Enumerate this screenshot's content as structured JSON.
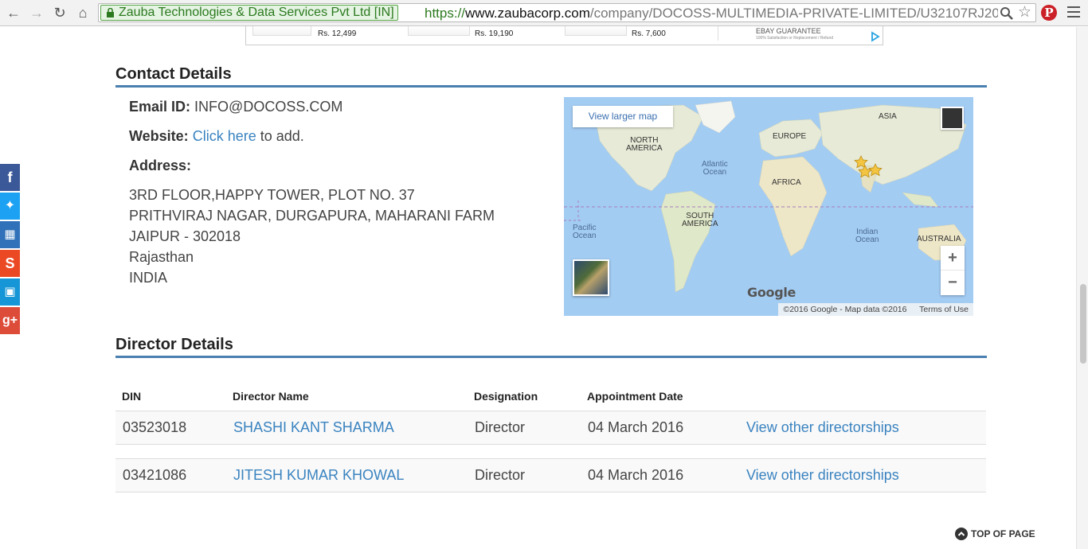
{
  "browser": {
    "ssl_label": "Zauba Technologies & Data Services Pvt Ltd [IN]",
    "url_scheme": "https://",
    "url_host": "www.zaubacorp.com",
    "url_path": "/company/DOCOSS-MULTIMEDIA-PRIVATE-LIMITED/U32107RJ20"
  },
  "ad": {
    "prices": [
      "Rs. 12,499",
      "Rs. 19,190",
      "Rs. 7,600"
    ],
    "guarantee": "EBAY GUARANTEE",
    "guarantee_sub": "100% Satisfaction or Replacement / Refund"
  },
  "social": [
    "facebook-icon",
    "twitter-icon",
    "delicious-icon",
    "stumbleupon-icon",
    "delicious-alt-icon",
    "google-plus-icon"
  ],
  "contact": {
    "title": "Contact Details",
    "email_label": "Email ID:",
    "email_value": "INFO@DOCOSS.COM",
    "website_label": "Website:",
    "website_link": "Click here",
    "website_suffix": "to add.",
    "address_label": "Address:",
    "address_lines": [
      "3RD FLOOR,HAPPY TOWER, PLOT NO. 37",
      "PRITHVIRAJ NAGAR, DURGAPURA, MAHARANI FARM",
      "JAIPUR - 302018",
      "Rajasthan",
      "INDIA"
    ]
  },
  "map": {
    "view_larger": "View larger map",
    "zoom_in": "+",
    "zoom_out": "−",
    "logo": "Google",
    "attribution": "©2016 Google - Map data ©2016",
    "terms": "Terms of Use",
    "labels": {
      "asia": "ASIA",
      "north_america": "NORTH\nAMERICA",
      "europe": "EUROPE",
      "atlantic": "Atlantic\nOcean",
      "africa": "AFRICA",
      "south_america": "SOUTH\nAMERICA",
      "pacific": "Pacific\nOcean",
      "indian": "Indian\nOcean",
      "australia": "AUSTRALIA"
    }
  },
  "directors": {
    "title": "Director Details",
    "headers": [
      "DIN",
      "Director Name",
      "Designation",
      "Appointment Date"
    ],
    "rows": [
      {
        "din": "03523018",
        "name": "SHASHI KANT SHARMA",
        "designation": "Director",
        "date": "04 March 2016",
        "action": "View other directorships"
      },
      {
        "din": "03421086",
        "name": "JITESH KUMAR KHOWAL",
        "designation": "Director",
        "date": "04 March 2016",
        "action": "View other directorships"
      }
    ]
  },
  "footer": {
    "top_of_page": "TOP OF PAGE"
  },
  "colors": {
    "accent": "#3a83c0",
    "rule": "#4a7fb0",
    "facebook": "#3b5998",
    "twitter": "#1da1f2",
    "delicious": "#3399ff",
    "stumbleupon": "#eb4924",
    "google_plus": "#dd4b39"
  }
}
